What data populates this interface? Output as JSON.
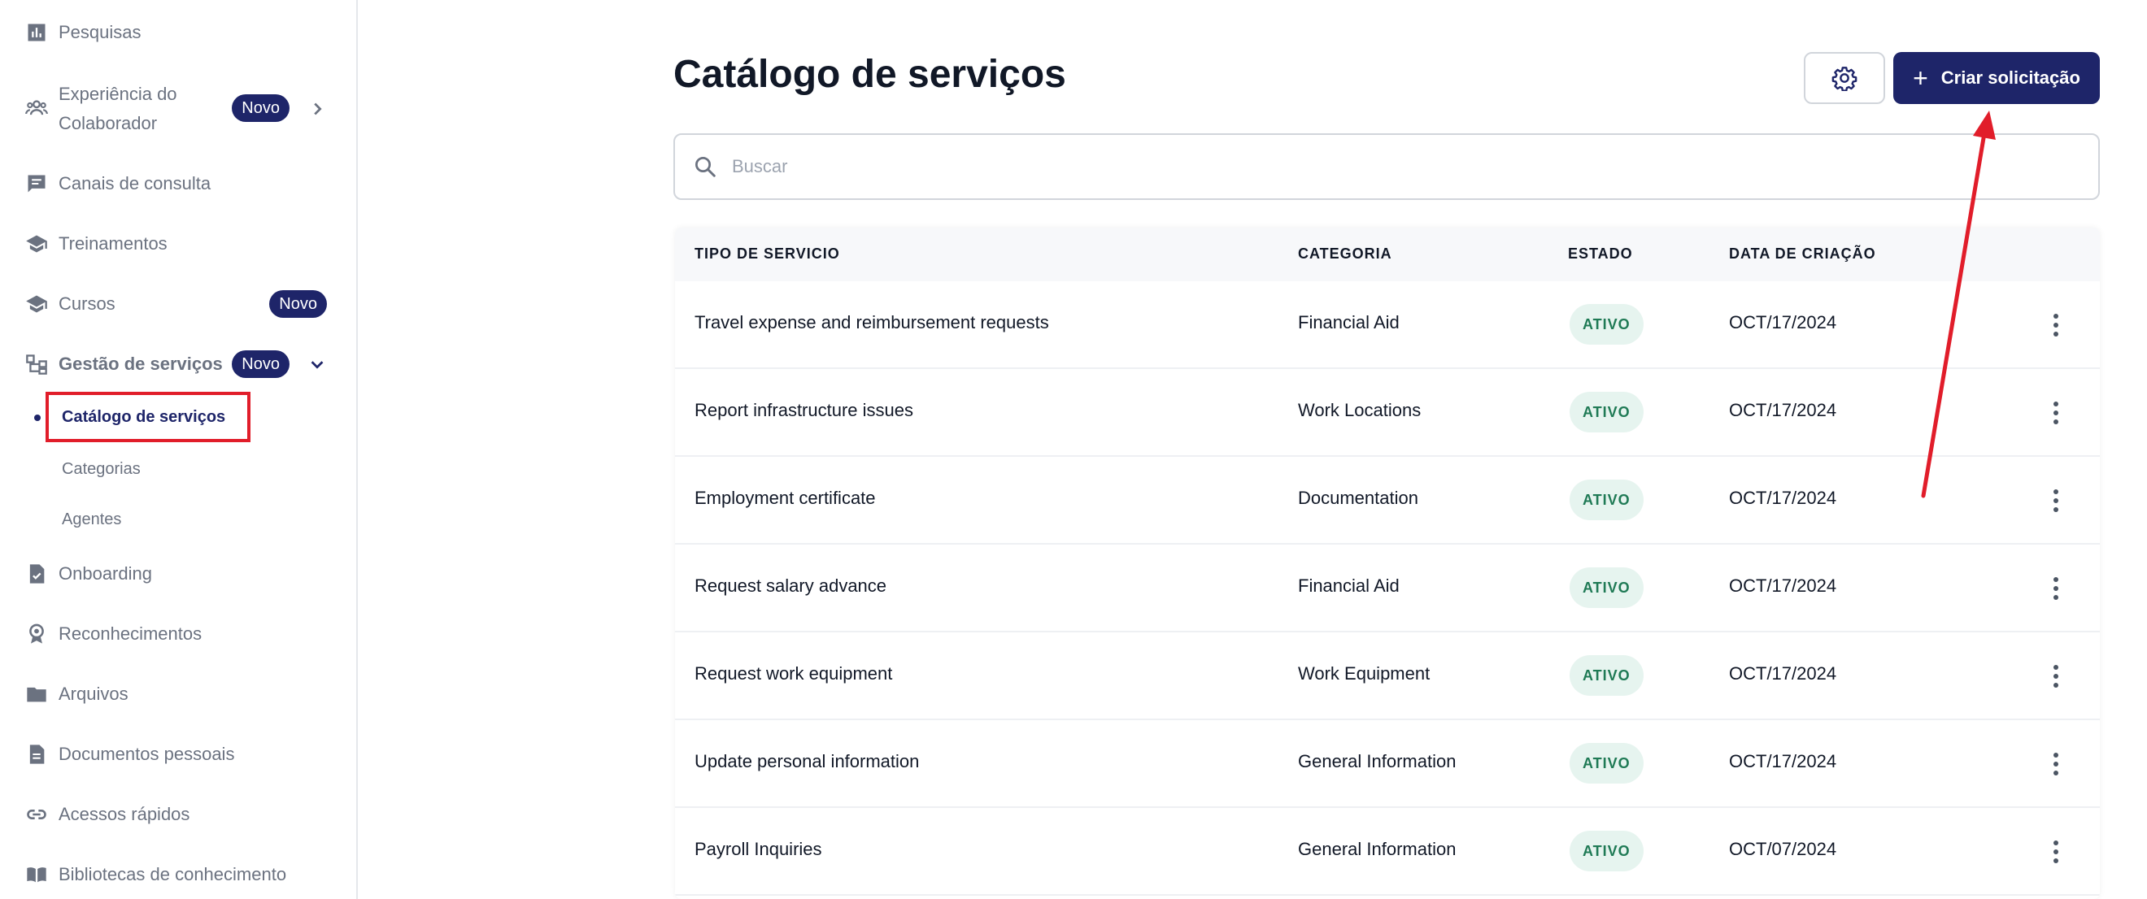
{
  "sidebar": {
    "items": [
      {
        "label": "Pesquisas",
        "icon": "bar-chart-icon"
      },
      {
        "label": "Experiência do",
        "label2": "Colaborador",
        "icon": "people-icon",
        "badge": "Novo"
      },
      {
        "label": "Canais de consulta",
        "icon": "chat-icon"
      },
      {
        "label": "Treinamentos",
        "icon": "graduation-cap-icon"
      },
      {
        "label": "Cursos",
        "icon": "graduation-cap-icon",
        "badge": "Novo"
      },
      {
        "label": "Gestão de serviços",
        "icon": "hierarchy-icon",
        "badge": "Novo"
      },
      {
        "label": "Onboarding",
        "icon": "document-check-icon"
      },
      {
        "label": "Reconhecimentos",
        "icon": "award-icon"
      },
      {
        "label": "Arquivos",
        "icon": "folder-icon"
      },
      {
        "label": "Documentos pessoais",
        "icon": "document-icon"
      },
      {
        "label": "Acessos rápidos",
        "icon": "link-icon"
      },
      {
        "label": "Bibliotecas de conhecimento",
        "icon": "book-icon"
      }
    ],
    "sub_items": {
      "active": "Catálogo de serviços",
      "categorias": "Categorias",
      "agentes": "Agentes"
    }
  },
  "main": {
    "title": "Catálogo de serviços",
    "create_button": "Criar solicitação",
    "search_placeholder": "Buscar",
    "columns": [
      "TIPO DE SERVICIO",
      "CATEGORIA",
      "ESTADO",
      "DATA DE CRIAÇÃO"
    ],
    "rows": [
      {
        "service": "Travel expense and reimbursement requests",
        "category": "Financial Aid",
        "status": "ATIVO",
        "date": "OCT/17/2024"
      },
      {
        "service": "Report infrastructure issues",
        "category": "Work Locations",
        "status": "ATIVO",
        "date": "OCT/17/2024"
      },
      {
        "service": "Employment certificate",
        "category": "Documentation",
        "status": "ATIVO",
        "date": "OCT/17/2024"
      },
      {
        "service": "Request salary advance",
        "category": "Financial Aid",
        "status": "ATIVO",
        "date": "OCT/17/2024"
      },
      {
        "service": "Request work equipment",
        "category": "Work Equipment",
        "status": "ATIVO",
        "date": "OCT/17/2024"
      },
      {
        "service": "Update personal information",
        "category": "General Information",
        "status": "ATIVO",
        "date": "OCT/17/2024"
      },
      {
        "service": "Payroll Inquiries",
        "category": "General Information",
        "status": "ATIVO",
        "date": "OCT/07/2024"
      }
    ]
  },
  "colors": {
    "brand": "#1e2569",
    "highlight": "#e11d2a",
    "status_bg": "#e6f4ef",
    "status_text": "#1f7a55"
  }
}
